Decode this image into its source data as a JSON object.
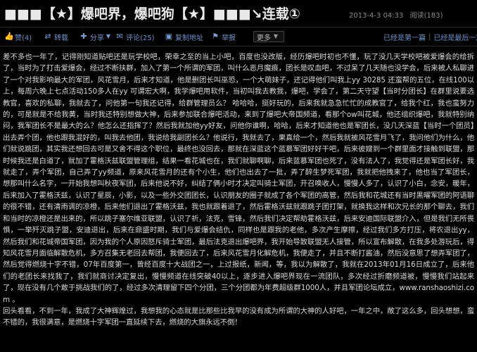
{
  "header": {
    "title": "■■■【★】爆吧界，爆吧狗【★】■■■↘连载①",
    "date": "2013-4-3 04:33",
    "views": "阅读(183)"
  },
  "toolbar": {
    "like": "赞(4)",
    "repost": "转载",
    "share": "分享",
    "comment": "评论(25)",
    "copy": "复制地址",
    "report": "举报",
    "more": "更多",
    "first": "已经是第一篇",
    "divider": "|",
    "last": "已经是最后一篇"
  },
  "article": {
    "paragraphs": [
      "差不多也一年了，记得刚知道贴吧还是玩学校吧，荣幸之至的当上小吧，百度也没改版，经历爆吧时初也不懂，玩了没几天学校吧被爱爆会的给拆了，当时为了打击爱爆会，经过不断扶群，加入了第一个所谓的军团，叫什么恶月魔痕，团长是叹血吧，不过呆了几天随也没学会，后来被人私聊进了一个对我影响最大的军团，风花雪月，后来才知道，他是删团长叫巫恐，一个大萌妹子，还记得他们叫我上yy 30285 还蛮帮的五位，在线100以上，每周六晚上七点活动150多人在yy 可谓宏大啊，我学爆吧用软件，当初叫我去教我，爆吧，学会了，第二天守望【当时分团长】在群里说要选教官，喜欢的私聊，我就去了，问他第一句我还记得，给群管理员么？    哈哈哈，挺好玩的，后来我就急急忙忙的成教官了，给我个红，我也蛮努力的，可是就是不给我黄，当时我还特别想做大神，后来参加联合爆吧活动，来到了爆吧大帝国频道，看那个ow叫花城，他还组织爆吧，我就特别纳闷，我军团长不是最大的么？他怎么还指挥了？然后我就加他yy好友，问他你谁啊，哈哈，后来才知道他也是军团长，没几天深蓝【当时一个团员】出去弄个团，他也跟我混好的，叫我去他团，我说给我副团长么？他说行，我就去了，果真给一个，然后我就被风花雪月飞了，我问他们为什么，他们就说跳团，其实我还想回去可是又舍不得这个职位，最终也没回去，那就在深蓝这个蓝慕军团好好干吧，后来彼嫂到一个群里面才接触到联盟，那时候我还是白道了，就加了霍格沃兹联盟管理组，结果一看花城也在，我们就聊啊聊，后来蓝慕军团也死了，没有法人了，我觉得还是军团长好，我就走了，弄个军团，自己弄了yy频道，原来风花雪月的还有个小生，他们也出去了一批，弄了醉生梦死军团，我就把他拽来了，他也当了军团长，想那叫什么名字，一开始我想叫秋夜军团，后来他说不好，纠结了俩小时才决定叫骑士军团，开召唤收人，慢慢人多了，认识了小白，念安，暖年，后来加入了霍格沃兹，认识了星辰，小影，以及一些外交团团长，认识朋友的圈子就成了各个军团的高管，然后我和花城还有当时黑曜军团的阿语聊的很不错，还有清雨调的凉橙，后来他们退出了霍格沃兹，我也就跟着退了，然后霍格沃兹就跟跳子团打架，就换我这样和次兄长的那个聊去，我们和当时的凉橙还是出来的，所以跳子塞尔维亚联盟，认识了祈，法克，雪锋，然后我们决定帮助霍格沃兹，后来安迪国际联盟介入，但是我们无所畏惧，一举歼灭跳子盟，安迪退出，后来在鼎盛时期，我们与爱爆会结仇，同样也是跟我的老他，多次产生摩擦，经过我们多方打压，将农退出yy，然后我们和花城帝国军团，因为我的个人原因怒斥骑士军团，最后法克退出爆吧界，我开始导致联盟无人接管，所以宣布解散，在我多处游玩后，得知风花雪月面临解散危机，多方召集无老回去帮团，我便回去了，后来风花雪月化解危机，我便走了，并且不断打酱油，然后没意思了想弄军团了，然后觉得燃烧十字不错，07年百度第一，曾经百度十大战团之一，上过报纸，新闻，等，我以为解散了，我就在2013年01月16日成立了，后来他们的老团长来找我了，我们就商讨决定复出，慢慢频道在线突破40以上，逐步进入爆吧界现在一流团队，多次经过折磨频道被，慢慢我们站起来了，现在没有几个敢于挑战我们的了，经过多次清理留下四个分团，三个分团都为年费超级群1000人，并且军团论坛成立，www.ranshaoshizi.com   。",
      "回头看看，不到一年，我成了大神辉煌过，我想我的心态就是比那些比我早的没有成为所谓的大神的人好吧，一年之中，敞了这么多，回头想想，蛮不错的，我很满意，是燃烧十字军团一直延续下去，燃烧的大旗永远不倒！"
    ]
  }
}
